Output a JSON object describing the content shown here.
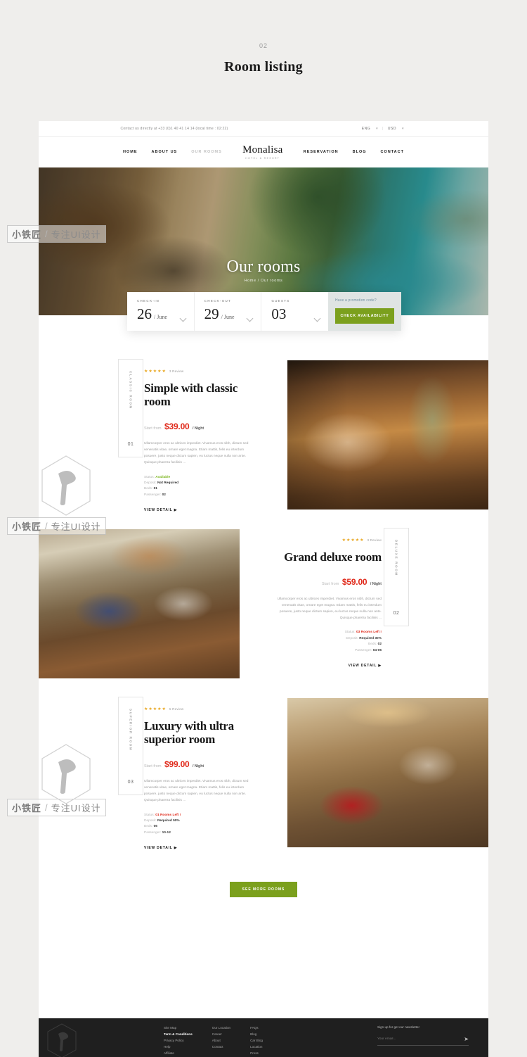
{
  "page": {
    "number": "02",
    "title": "Room listing"
  },
  "topbar": {
    "contact": "Contact us directly at  +33 (0)1 40 41 14 14 (local time : 02:22)",
    "lang": "ENG",
    "currency": "USD",
    "separator": "|"
  },
  "nav": {
    "left": [
      {
        "label": "HOME",
        "active": true
      },
      {
        "label": "ABOUT US",
        "active": true
      },
      {
        "label": "OUR ROOMS",
        "active": false
      }
    ],
    "right": [
      {
        "label": "RESERVATION"
      },
      {
        "label": "BLOG"
      },
      {
        "label": "CONTACT"
      }
    ],
    "logo": {
      "name": "Monalisa",
      "tagline": "HOTEL & RESORT"
    }
  },
  "hero": {
    "title": "Our rooms",
    "breadcrumb": "Home / Our rooms"
  },
  "booking": {
    "checkin": {
      "label": "CHECK-IN",
      "day": "26",
      "month": "/ June"
    },
    "checkout": {
      "label": "CHECK-OUT",
      "day": "29",
      "month": "/ June"
    },
    "guests": {
      "label": "GUESTS",
      "value": "03",
      "month": ""
    },
    "promo_text": "Have a promotion code?",
    "submit_label": "CHECK AVAILABILITY"
  },
  "rooms": [
    {
      "badge_label": "CLASSIC ROOM",
      "badge_number": "01",
      "stars": "★★★★★",
      "reviews": "3 Review",
      "title": "Simple with classic room",
      "price_from": "Start from",
      "price": "$39.00",
      "per": "/ Night",
      "desc": "Ullamcorper eros ac ultrices imperdiet. Vivamus eros nibh, dictum sed venenatis vitae, ornare eget magna. Etiam mattis, felis eu interdum posuere, justo neque dictum sapien, eu luctus neque nulla non ante. Quisque pharetra facilisis ...",
      "status_key": "Status:",
      "status_value": "Available",
      "status_color": "green",
      "deposit_key": "Deposit:",
      "deposit_value": "Not Required",
      "beds_key": "Beds:",
      "beds_value": "01",
      "passenger_key": "Passenger:",
      "passenger_value": "02",
      "cta": "VIEW DETAIL"
    },
    {
      "badge_label": "DELUXE ROOM",
      "badge_number": "02",
      "stars": "★★★★★",
      "reviews": "3 Review",
      "title": "Grand deluxe room",
      "price_from": "Start from",
      "price": "$59.00",
      "per": "/ Night",
      "desc": "Ullamcorper eros ac ultrices imperdiet. Vivamus eros nibh, dictum sed venenatis vitae, ornare eget magna. Etiam mattis, felis eu interdum posuere, justo neque dictum sapien, eu luctus neque nulla non ante. Quisque pharetra facilisis ...",
      "status_key": "Status:",
      "status_value": "03 Rooms Left !",
      "status_color": "red",
      "deposit_key": "Deposit:",
      "deposit_value": "Required 30%",
      "beds_key": "Beds:",
      "beds_value": "02",
      "passenger_key": "Passenger:",
      "passenger_value": "04-06",
      "cta": "VIEW DETAIL"
    },
    {
      "badge_label": "SUPERIOR ROOM",
      "badge_number": "03",
      "stars": "★★★★★",
      "reviews": "5 Review",
      "title": "Luxury with ultra superior room",
      "price_from": "Start from",
      "price": "$99.00",
      "per": "/ Night",
      "desc": "Ullamcorper eros ac ultrices imperdiet. Vivamus eros nibh, dictum sed venenatis vitae, ornare eget magna. Etiam mattis, felis eu interdum posuere, justo neque dictum sapien, eu luctus neque nulla non ante. Quisque pharetra facilisis ...",
      "status_key": "Status:",
      "status_value": "01 Rooms Left !",
      "status_color": "red",
      "deposit_key": "Deposit:",
      "deposit_value": "Required 50%",
      "beds_key": "Beds:",
      "beds_value": "06",
      "passenger_key": "Passenger:",
      "passenger_value": "10-12",
      "cta": "VIEW DETAIL"
    }
  ],
  "see_more_label": "SEE MORE ROOMS",
  "footer": {
    "columns": [
      [
        {
          "label": "Site Map",
          "bold": false
        },
        {
          "label": "Term & Conditions",
          "bold": true
        },
        {
          "label": "Privacy Policy",
          "bold": false
        },
        {
          "label": "Help",
          "bold": false
        },
        {
          "label": "Affiliate",
          "bold": false
        }
      ],
      [
        {
          "label": "Our Location",
          "bold": false
        },
        {
          "label": "Career",
          "bold": false
        },
        {
          "label": "About",
          "bold": false
        },
        {
          "label": "Contact",
          "bold": false
        }
      ],
      [
        {
          "label": "FAQs",
          "bold": false
        },
        {
          "label": "Blog",
          "bold": false
        },
        {
          "label": "Car Blog",
          "bold": false
        },
        {
          "label": "Location",
          "bold": false
        },
        {
          "label": "Press",
          "bold": false
        }
      ]
    ],
    "newsletter": {
      "title": "Sign up for get our newsletter",
      "placeholder": "Your email...",
      "value": ""
    }
  },
  "watermark": {
    "brand": "小铁匠",
    "slash": "/",
    "tagline": "专注UI设计"
  },
  "colors": {
    "accent_green": "#7ba01d",
    "price_red": "#e02b1c",
    "status_green": "#7cb61f",
    "star_gold": "#e8a51c",
    "footer_bg": "#1f1f1f"
  }
}
